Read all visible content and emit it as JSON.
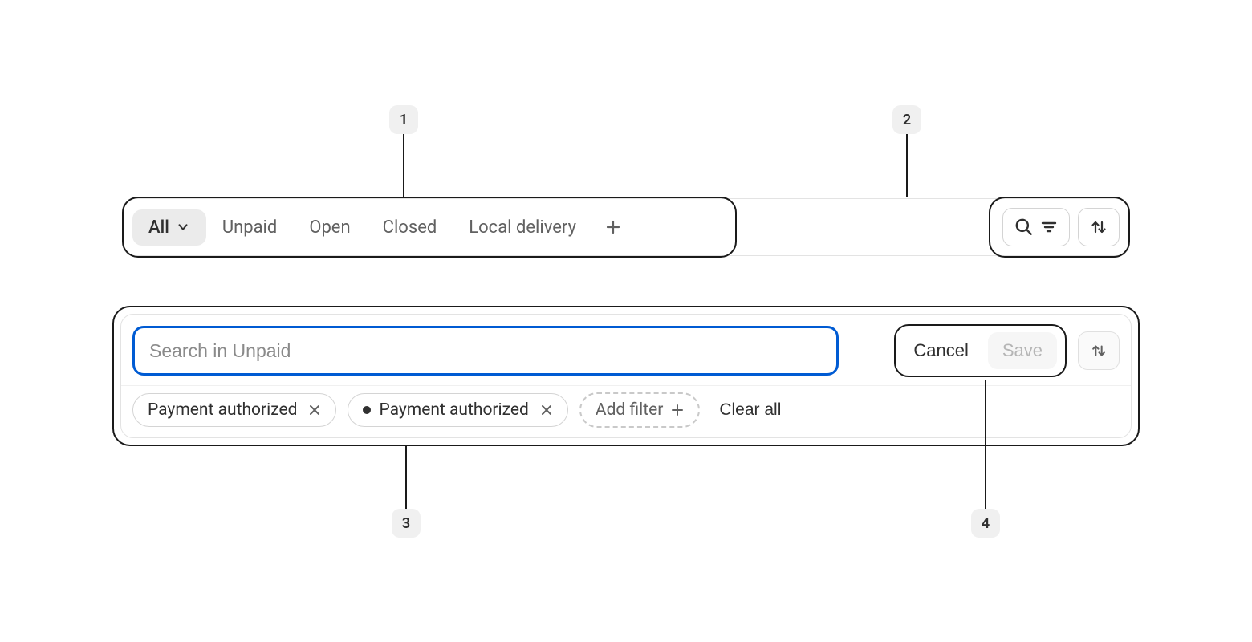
{
  "callouts": {
    "c1": "1",
    "c2": "2",
    "c3": "3",
    "c4": "4"
  },
  "tabs": {
    "items": [
      {
        "label": "All"
      },
      {
        "label": "Unpaid"
      },
      {
        "label": "Open"
      },
      {
        "label": "Closed"
      },
      {
        "label": "Local delivery"
      }
    ]
  },
  "search": {
    "placeholder": "Search in Unpaid"
  },
  "actions": {
    "cancel": "Cancel",
    "save": "Save"
  },
  "filters": {
    "chip1": "Payment authorized",
    "chip2": "Payment authorized",
    "add_filter": "Add filter",
    "clear_all": "Clear all"
  }
}
